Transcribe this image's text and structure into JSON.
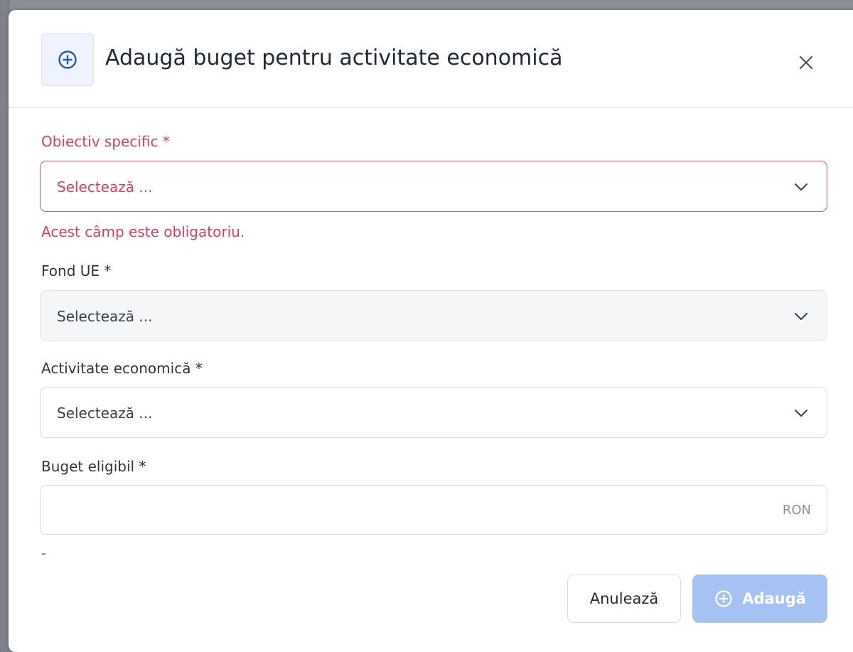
{
  "dialog": {
    "title": "Adaugă buget pentru activitate economică",
    "header_icon": "plus-circle-icon",
    "close_icon": "close-icon"
  },
  "fields": {
    "obiectiv": {
      "label": "Obiectiv specific *",
      "placeholder": "Selectează ...",
      "error": "Acest câmp este obligatoriu."
    },
    "fond": {
      "label": "Fond UE *",
      "placeholder": "Selectează ..."
    },
    "activitate": {
      "label": "Activitate economică *",
      "placeholder": "Selectează ..."
    },
    "buget": {
      "label": "Buget eligibil *",
      "value": "",
      "suffix": "RON",
      "hint": "-"
    }
  },
  "footer": {
    "cancel_label": "Anulează",
    "add_label": "Adaugă",
    "add_icon": "plus-circle-icon"
  },
  "colors": {
    "primary": "#2d56c4",
    "error": "#df3d63",
    "add_button_disabled": "#a6c2f3"
  }
}
